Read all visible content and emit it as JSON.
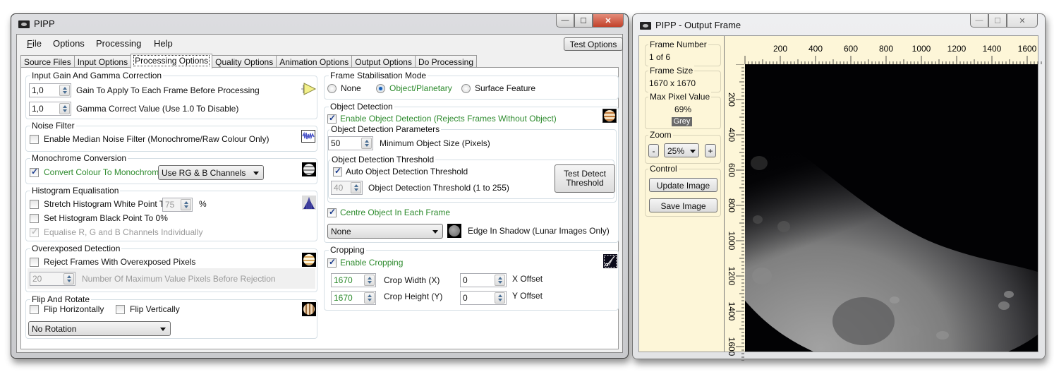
{
  "main_window": {
    "title": "PIPP",
    "window_controls": {
      "minimize": "—",
      "maximize": "☐",
      "close": "✕"
    },
    "menu": [
      {
        "label": "File",
        "accel": "F"
      },
      {
        "label": "Options"
      },
      {
        "label": "Processing"
      },
      {
        "label": "Help"
      }
    ],
    "test_options_button": "Test Options",
    "tabs": [
      {
        "label": "Source Files",
        "active": false
      },
      {
        "label": "Input Options",
        "active": false
      },
      {
        "label": "Processing Options",
        "active": true
      },
      {
        "label": "Quality Options",
        "active": false
      },
      {
        "label": "Animation Options",
        "active": false
      },
      {
        "label": "Output Options",
        "active": false
      },
      {
        "label": "Do Processing",
        "active": false
      }
    ],
    "gain_gamma": {
      "legend": "Input Gain And Gamma Correction",
      "gain_value": "1,0",
      "gain_label": "Gain To Apply To Each Frame Before Processing",
      "gamma_value": "1,0",
      "gamma_label": "Gamma Correct Value (Use 1.0 To Disable)",
      "icon": "play-triangle-icon"
    },
    "noise_filter": {
      "legend": "Noise Filter",
      "checkbox_label": "Enable Median Noise Filter (Monochrome/Raw Colour Only)",
      "checked": false,
      "icon": "noise-waveform-icon"
    },
    "monochrome": {
      "legend": "Monochrome Conversion",
      "checkbox_label": "Convert Colour To Monochrome",
      "checked": true,
      "channel_select": "Use RG & B Channels",
      "icon": "grey-planet-icon"
    },
    "histogram": {
      "legend": "Histogram Equalisation",
      "stretch_label": "Stretch Histogram White Point To:",
      "stretch_checked": false,
      "stretch_value": "75",
      "stretch_unit": "%",
      "black_label": "Set Histogram Black Point To 0%",
      "black_checked": false,
      "equalise_label": "Equalise R, G and B Channels Individually",
      "equalise_checked": true,
      "equalise_disabled": true,
      "icon": "histogram-icon"
    },
    "overexposed": {
      "legend": "Overexposed Detection",
      "checkbox_label": "Reject Frames With Overexposed Pixels",
      "checked": false,
      "pixels_value": "20",
      "pixels_label": "Number Of Maximum Value Pixels Before Rejection",
      "icon": "bright-planet-icon"
    },
    "flip_rotate": {
      "legend": "Flip And Rotate",
      "flip_h_label": "Flip Horizontally",
      "flip_h_checked": false,
      "flip_v_label": "Flip Vertically",
      "flip_v_checked": false,
      "rotation_select": "No Rotation",
      "icon": "rotated-planet-icon"
    },
    "stabilisation": {
      "legend": "Frame Stabilisation Mode",
      "options": [
        {
          "label": "None",
          "selected": false
        },
        {
          "label": "Object/Planetary",
          "selected": true
        },
        {
          "label": "Surface Feature",
          "selected": false
        }
      ]
    },
    "object_detection": {
      "legend": "Object Detection",
      "enable_label": "Enable Object Detection (Rejects Frames Without Object)",
      "enable_checked": true,
      "params_legend": "Object Detection Parameters",
      "min_size_value": "50",
      "min_size_label": "Minimum Object Size (Pixels)",
      "threshold_legend": "Object Detection Threshold",
      "auto_label": "Auto Object Detection Threshold",
      "auto_checked": true,
      "threshold_value": "40",
      "threshold_label": "Object Detection Threshold (1 to 255)",
      "test_button": "Test Detect Threshold",
      "centre_label": "Centre Object In Each Frame",
      "centre_checked": true,
      "edge_select": "None",
      "edge_label": "Edge In Shadow (Lunar Images Only)",
      "icon": "jupiter-icon",
      "edge_icon": "moon-icon"
    },
    "cropping": {
      "legend": "Cropping",
      "enable_label": "Enable Cropping",
      "enable_checked": true,
      "width_value": "1670",
      "width_label": "Crop Width (X)",
      "height_value": "1670",
      "height_label": "Crop Height (Y)",
      "x_offset_value": "0",
      "x_offset_label": "X Offset",
      "y_offset_value": "0",
      "y_offset_label": "Y Offset",
      "icon": "scissors-icon"
    }
  },
  "output_window": {
    "title": "PIPP - Output Frame",
    "window_controls": {
      "minimize": "—",
      "maximize": "☐",
      "close": "✕"
    },
    "frame_number": {
      "legend": "Frame Number",
      "value": "1 of 6"
    },
    "frame_size": {
      "legend": "Frame Size",
      "value": "1670 x 1670"
    },
    "max_pixel": {
      "legend": "Max Pixel Value",
      "value": "69%",
      "badge": "Grey"
    },
    "zoom": {
      "legend": "Zoom",
      "minus": "-",
      "value": "25%",
      "plus": "+"
    },
    "control": {
      "legend": "Control",
      "update_button": "Update Image",
      "save_button": "Save Image"
    },
    "ruler_x_labels": [
      "200",
      "400",
      "600",
      "800",
      "1000",
      "1200",
      "1400",
      "1600"
    ],
    "ruler_y_labels": [
      "200",
      "400",
      "600",
      "800",
      "1000",
      "1200",
      "1400",
      "1600"
    ],
    "image": "moon-crescent-image"
  }
}
